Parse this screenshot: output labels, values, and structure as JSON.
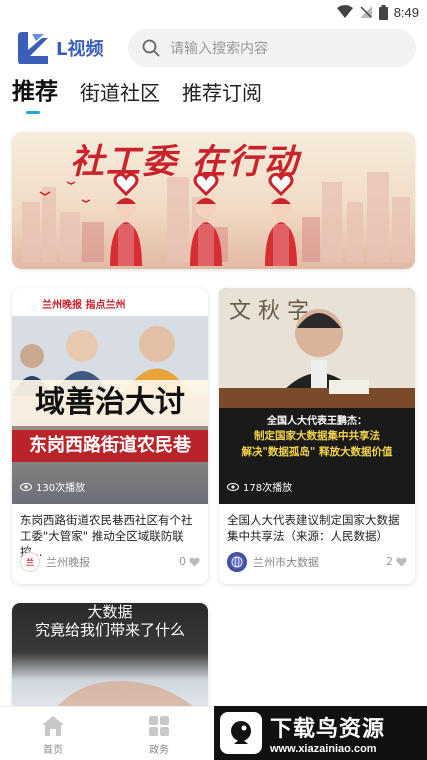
{
  "status_bar": {
    "time": "8:49"
  },
  "header": {
    "app_name": "L视频",
    "search_placeholder": "请输入搜索内容"
  },
  "tabs": [
    {
      "label": "推荐",
      "active": true
    },
    {
      "label": "街道社区",
      "active": false
    },
    {
      "label": "推荐订阅",
      "active": false
    }
  ],
  "banner": {
    "title": "社工委 在行动"
  },
  "cards": [
    {
      "thumb_caption_top": "域善治大讨",
      "thumb_caption_bottom": "东岗西路街道农民巷",
      "thumb_logos": "兰州晚报  指点兰州",
      "play_count": "130次播放",
      "title": "东岗西路街道农民巷西社区有个社工委\"大管家\" 推动全区域联防联控...",
      "source": "兰州晚报",
      "likes": "0"
    },
    {
      "thumb_caption_top": "全国人大代表王鹏杰：",
      "thumb_caption_mid": "制定国家大数据集中共享法",
      "thumb_caption_bottom": "解决\"数据孤岛\" 释放大数据价值",
      "play_count": "178次播放",
      "title": "全国人大代表建议制定国家大数据集中共享法（来源：人民数据）",
      "source": "兰州市大数据",
      "likes": "2"
    },
    {
      "thumb_caption_top": "大数据",
      "thumb_caption_bottom": "究竟给我们带来了什么"
    }
  ],
  "bottom_nav": [
    {
      "label": "首页",
      "icon": "home-icon"
    },
    {
      "label": "政务",
      "icon": "grid-icon"
    }
  ],
  "watermark": {
    "text": "下载鸟资源",
    "url": "www.xiazainiao.com"
  },
  "colors": {
    "accent": "#23a6e0",
    "brand": "#3b5fb8",
    "banner_red": "#c9242b"
  }
}
